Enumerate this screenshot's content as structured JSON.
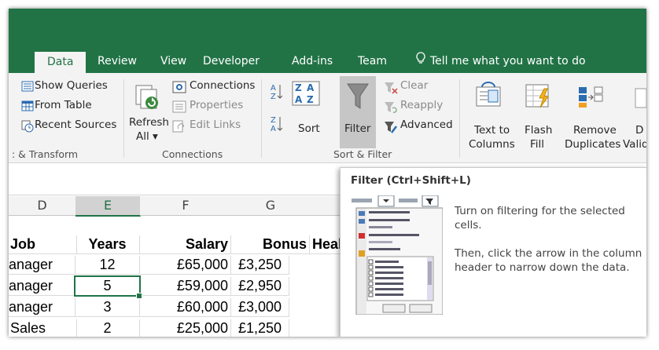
{
  "ribbon_tabs": [
    "Data",
    "Review",
    "View",
    "Developer",
    "Add-ins",
    "Team"
  ],
  "tell_me": "Tell me what you want to do",
  "get_transform": {
    "items": [
      "Show Queries",
      "From Table",
      "Recent Sources"
    ],
    "group_label": ": & Transform"
  },
  "connections": {
    "refresh_line1": "Refresh",
    "refresh_line2": "All ▾",
    "items": [
      "Connections",
      "Properties",
      "Edit Links"
    ],
    "group_label": "Connections"
  },
  "sort_filter": {
    "sort_label": "Sort",
    "filter_label": "Filter",
    "clear": "Clear",
    "reapply": "Reapply",
    "advanced": "Advanced",
    "group_label": "Sort & Filter"
  },
  "data_tools": {
    "text_to_columns_1": "Text to",
    "text_to_columns_2": "Columns",
    "flash_fill_1": "Flash",
    "flash_fill_2": "Fill",
    "remove_duplicates_1": "Remove",
    "remove_duplicates_2": "Duplicates",
    "validation_1": "D",
    "validation_2": "Valid"
  },
  "sheet": {
    "columns": [
      "D",
      "E",
      "F",
      "G"
    ],
    "header": [
      "Job",
      "Years",
      "Salary",
      "Bonus",
      "Heal"
    ],
    "rows": [
      [
        "anager",
        "12",
        "£65,000",
        "£3,250"
      ],
      [
        "anager",
        "5",
        "£59,000",
        "£2,950"
      ],
      [
        "anager",
        "3",
        "£60,000",
        "£3,000"
      ],
      [
        "Sales",
        "2",
        "£25,000",
        "£1,250"
      ]
    ]
  },
  "tooltip": {
    "title": "Filter (Ctrl+Shift+L)",
    "line1": "Turn on filtering for the selected cells.",
    "line2": "Then, click the arrow in the column header to narrow down the data."
  },
  "colors": {
    "excel_green": "#217346",
    "ribbon_bg": "#f3f3f3",
    "filter_pressed": "#c6c6c6"
  }
}
